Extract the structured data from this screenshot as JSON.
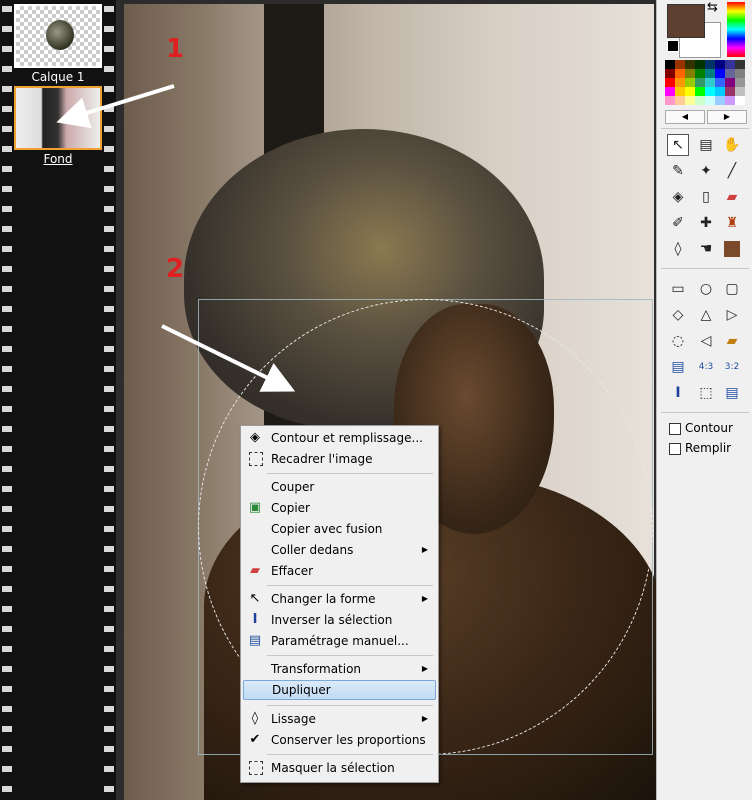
{
  "layers": [
    {
      "name": "Calque 1",
      "selected": false
    },
    {
      "name": "Fond",
      "selected": true
    }
  ],
  "annotations": [
    "1",
    "2"
  ],
  "menu": {
    "items": [
      {
        "id": "contour-remplissage",
        "label": "Contour et remplissage...",
        "icon": "paint-bucket-icon",
        "glyph": "◈",
        "submenu": false
      },
      {
        "id": "recadrer",
        "label": "Recadrer l'image",
        "icon": "crop-icon",
        "glyph": "⬚",
        "submenu": false
      },
      {
        "id": "couper",
        "label": "Couper",
        "icon": "",
        "glyph": "",
        "submenu": false
      },
      {
        "id": "copier",
        "label": "Copier",
        "icon": "copy-image-icon",
        "glyph": "▣",
        "submenu": false
      },
      {
        "id": "copier-fusion",
        "label": "Copier avec fusion",
        "icon": "",
        "glyph": "",
        "submenu": false
      },
      {
        "id": "coller-dedans",
        "label": "Coller dedans",
        "icon": "",
        "glyph": "",
        "submenu": true
      },
      {
        "id": "effacer",
        "label": "Effacer",
        "icon": "eraser-icon",
        "glyph": "▰",
        "submenu": false
      },
      {
        "id": "changer-forme",
        "label": "Changer la forme",
        "icon": "pointer-icon",
        "glyph": "↖",
        "submenu": true
      },
      {
        "id": "inverser",
        "label": "Inverser la sélection",
        "icon": "invert-selection-icon",
        "glyph": "I",
        "submenu": false
      },
      {
        "id": "parametrage",
        "label": "Paramétrage manuel...",
        "icon": "manual-settings-icon",
        "glyph": "▤",
        "submenu": false
      },
      {
        "id": "transformation",
        "label": "Transformation",
        "icon": "",
        "glyph": "",
        "submenu": true
      },
      {
        "id": "dupliquer",
        "label": "Dupliquer",
        "icon": "",
        "glyph": "",
        "submenu": false,
        "highlighted": true
      },
      {
        "id": "lissage",
        "label": "Lissage",
        "icon": "drop-icon",
        "glyph": "◊",
        "submenu": true
      },
      {
        "id": "conserver",
        "label": "Conserver les proportions",
        "icon": "checkmark-icon",
        "glyph": "✔",
        "submenu": false
      },
      {
        "id": "masquer",
        "label": "Masquer la sélection",
        "icon": "hide-selection-icon",
        "glyph": "⬚",
        "submenu": false
      }
    ]
  },
  "colors": {
    "current": "#5e4030",
    "background": "#ffffff",
    "palette": [
      "#000000",
      "#993300",
      "#333300",
      "#003300",
      "#003366",
      "#000080",
      "#333399",
      "#333333",
      "#800000",
      "#ff6600",
      "#808000",
      "#008000",
      "#008080",
      "#0000ff",
      "#666699",
      "#808080",
      "#ff0000",
      "#ff9900",
      "#99cc00",
      "#339966",
      "#33cccc",
      "#3366ff",
      "#800080",
      "#969696",
      "#ff00ff",
      "#ffcc00",
      "#ffff00",
      "#00ff00",
      "#00ffff",
      "#00ccff",
      "#993366",
      "#c0c0c0",
      "#ff99cc",
      "#ffcc99",
      "#ffff99",
      "#ccffcc",
      "#ccffff",
      "#99ccff",
      "#cc99ff",
      "#ffffff"
    ]
  },
  "tools": {
    "checkboxes": [
      {
        "id": "contour",
        "label": "Contour",
        "checked": false
      },
      {
        "id": "remplir",
        "label": "Remplir",
        "checked": false
      }
    ]
  }
}
